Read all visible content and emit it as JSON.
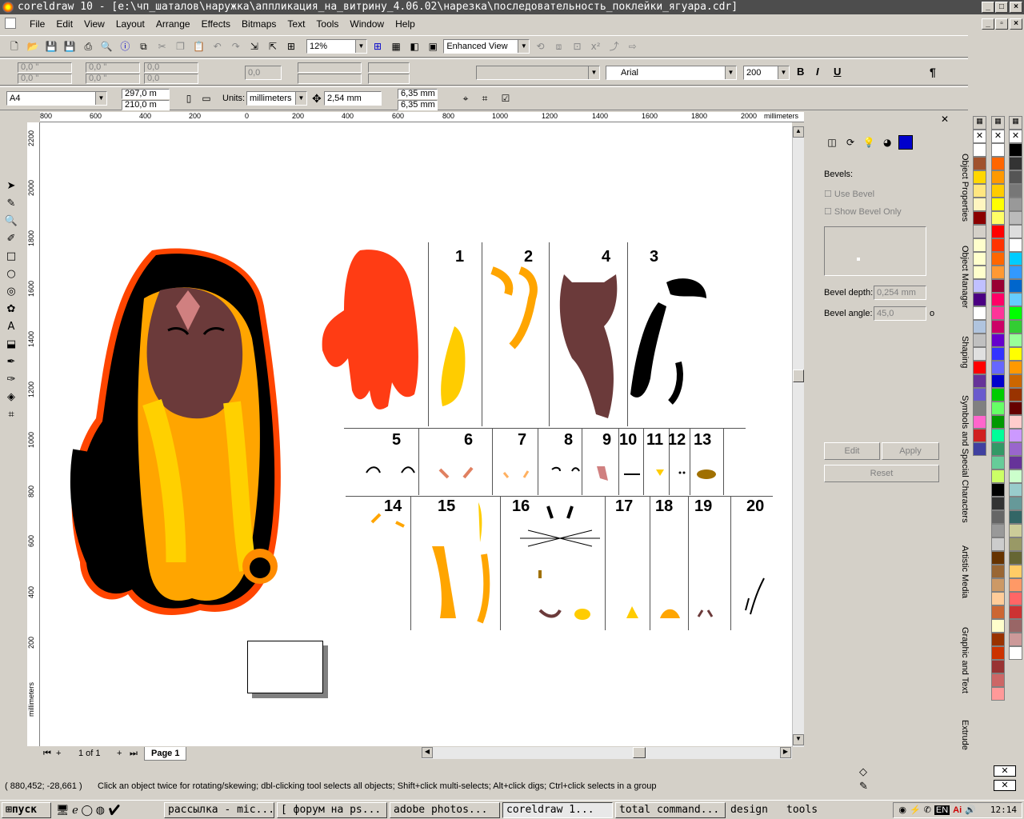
{
  "window": {
    "title": "coreldraw 10 - [e:\\чп_шаталов\\наружка\\аппликация_на_витрину_4.06.02\\нарезка\\последовательность_поклейки_ягуара.cdr]"
  },
  "menu": [
    "File",
    "Edit",
    "View",
    "Layout",
    "Arrange",
    "Effects",
    "Bitmaps",
    "Text",
    "Tools",
    "Window",
    "Help"
  ],
  "toolbar": {
    "zoom": "12%",
    "view_mode": "Enhanced View"
  },
  "property_bar": {
    "x1": "0,0 \"",
    "y1": "0,0 \"",
    "w1": "0,0 \"",
    "h1": "0,0 \"",
    "s1": "0,0",
    "s2": "0,0",
    "rot": "0,0",
    "font": "Arial",
    "font_size": "200",
    "bold": "B",
    "italic": "I",
    "underline": "U",
    "para": "¶"
  },
  "page_bar": {
    "paper": "A4",
    "width": "297,0 m",
    "height": "210,0 m",
    "units_label": "Units:",
    "units": "millimeters",
    "nudge": "2,54 mm",
    "dup_x": "6,35 mm",
    "dup_y": "6,35 mm"
  },
  "ruler": {
    "unit": "millimeters",
    "h_ticks": [
      "800",
      "600",
      "400",
      "200",
      "0",
      "200",
      "400",
      "600",
      "800",
      "1000",
      "1200",
      "1400",
      "1600",
      "1800",
      "2000"
    ],
    "v_ticks": [
      "2200",
      "2000",
      "1800",
      "1600",
      "1400",
      "1200",
      "1000",
      "800",
      "600",
      "400",
      "200"
    ],
    "v_unit": "millimeters"
  },
  "canvas": {
    "labels": [
      "1",
      "2",
      "4",
      "3",
      "5",
      "6",
      "7",
      "8",
      "9",
      "10",
      "11",
      "12",
      "13",
      "14",
      "15",
      "16",
      "17",
      "18",
      "19",
      "20"
    ]
  },
  "page_nav": {
    "pages": "1 of 1",
    "tab": "Page 1"
  },
  "docker": {
    "section": "Bevels:",
    "use_bevel": "Use Bevel",
    "show_bevel_only": "Show Bevel Only",
    "depth_label": "Bevel depth:",
    "depth": "0,254 mm",
    "angle_label": "Bevel angle:",
    "angle": "45,0",
    "angle_unit": "o",
    "edit": "Edit",
    "apply": "Apply",
    "reset": "Reset"
  },
  "docker_tabs": [
    "Object Properties",
    "Object Manager",
    "Shaping",
    "Symbols and Special Characters",
    "Artistic Media",
    "Graphic and Text",
    "Extrude"
  ],
  "palette1": [
    "#ffffff",
    "#a0522d",
    "#ffd700",
    "#ffe680",
    "#fff5c0",
    "#8b0000",
    "#d4d0c8",
    "#ffffcc",
    "#ffffcc",
    "#ffffcc",
    "#c0c0ff",
    "#4b0082",
    "#ffffff",
    "#b0c4de",
    "#c0c0c0",
    "#e0e0e0",
    "#ff0000",
    "#663399",
    "#6a5acd",
    "#808080",
    "#ff66cc",
    "#d02020",
    "#4040a0",
    "#ff6600"
  ],
  "palette2": [
    "#ffffff",
    "#ff6600",
    "#ff9900",
    "#ffcc00",
    "#ffff00",
    "#ffff66",
    "#ff0000",
    "#ff3300",
    "#ff6600",
    "#ff9933",
    "#990033",
    "#ff0066",
    "#ff3399",
    "#cc0066",
    "#6600cc",
    "#3333ff",
    "#6666ff",
    "#0000cc",
    "#00cc00",
    "#66ff66",
    "#009900",
    "#00ff99",
    "#339966",
    "#66cc99",
    "#ccff66",
    "#000000",
    "#333333",
    "#666666",
    "#999999",
    "#cccccc",
    "#663300",
    "#996633",
    "#cc9966",
    "#ffcc99",
    "#cc6633",
    "#ffffcc",
    "#993300",
    "#cc3300",
    "#993333",
    "#cc6666",
    "#ff9999"
  ],
  "palette3": [
    "#000000",
    "#333333",
    "#555555",
    "#777777",
    "#999999",
    "#bbbbbb",
    "#dddddd",
    "#ffffff",
    "#00ccff",
    "#3399ff",
    "#0066cc",
    "#66ccff",
    "#00ff00",
    "#33cc33",
    "#99ff99",
    "#ffff00",
    "#ff9900",
    "#cc6600",
    "#993300",
    "#660000",
    "#ffcccc",
    "#cc99ff",
    "#9966cc",
    "#663399",
    "#ccffcc",
    "#99cccc",
    "#669999",
    "#336666",
    "#cccc99",
    "#999966",
    "#666633",
    "#ffcc66",
    "#ff9966",
    "#ff6666",
    "#cc3333",
    "#996666",
    "#cc9999",
    "#ffffff"
  ],
  "status": {
    "coords": "( 880,452; -28,661 )",
    "hint": "Click an object twice for rotating/skewing; dbl-clicking tool selects all objects; Shift+click multi-selects; Alt+click digs; Ctrl+click selects in a group"
  },
  "taskbar": {
    "start": "пуск",
    "tasks": [
      "рассылка - mic...",
      "[ форум на ps...",
      "adobe photos...",
      "coreldraw 1...",
      "total command..."
    ],
    "quick": [
      "design",
      "tools"
    ],
    "lang": "EN",
    "clock": "12:14"
  }
}
